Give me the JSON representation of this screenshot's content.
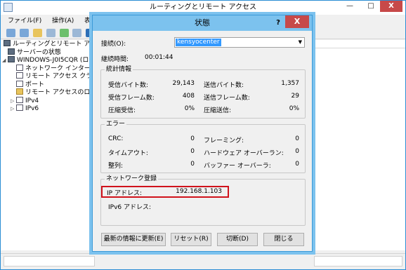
{
  "main": {
    "title": "ルーティングとリモート アクセス",
    "window_buttons": {
      "minimize": "—",
      "maximize": "□",
      "close": "X"
    },
    "menu": [
      "ファイル(F)",
      "操作(A)",
      "表示(V)"
    ],
    "tree": [
      {
        "label": "ルーティングとリモート アクセス",
        "icon": "server-icon",
        "expander": ""
      },
      {
        "label": "サーバーの状態",
        "icon": "server-icon",
        "expander": ""
      },
      {
        "label": "WINDOWS-J0I5CQR (ロ",
        "icon": "server-icon",
        "expander": "◢"
      },
      {
        "label": "ネットワーク インターフェ",
        "icon": "interface-icon",
        "expander": ""
      },
      {
        "label": "リモート アクセス クライア",
        "icon": "interface-icon",
        "expander": ""
      },
      {
        "label": "ポート",
        "icon": "interface-icon",
        "expander": ""
      },
      {
        "label": "リモート アクセスのログと",
        "icon": "folder-icon",
        "expander": ""
      },
      {
        "label": "IPv4",
        "icon": "interface-icon",
        "expander": "▷"
      },
      {
        "label": "IPv6",
        "icon": "interface-icon",
        "expander": "▷"
      }
    ]
  },
  "dialog": {
    "title": "状態",
    "help": "?",
    "close": "X",
    "connection_label": "接続(O):",
    "connection_value": "kensyocenter",
    "duration_label": "継続時間:",
    "duration_value": "00:01:44",
    "stats": {
      "title": "統計情報",
      "bytes_received_label": "受信バイト数:",
      "bytes_received": "29,143",
      "bytes_sent_label": "送信バイト数:",
      "bytes_sent": "1,357",
      "frames_received_label": "受信フレーム数:",
      "frames_received": "408",
      "frames_sent_label": "送信フレーム数:",
      "frames_sent": "29",
      "compression_in_label": "圧縮受信:",
      "compression_in": "0%",
      "compression_out_label": "圧縮送信:",
      "compression_out": "0%"
    },
    "errors": {
      "title": "エラー",
      "crc_label": "CRC:",
      "crc": "0",
      "framing_label": "フレーミング:",
      "framing": "0",
      "timeout_label": "タイムアウト:",
      "timeout": "0",
      "hw_overrun_label": "ハードウェア オーバーラン:",
      "hw_overrun": "0",
      "alignment_label": "整列:",
      "alignment": "0",
      "buffer_overrun_label": "バッファー オーバーラ:",
      "buffer_overrun": "0"
    },
    "network": {
      "title": "ネットワーク登録",
      "ip_label": "IP アドレス:",
      "ip_value": "192.168.1.103",
      "ipv6_label": "IPv6 アドレス:",
      "ipv6_value": ""
    },
    "buttons": {
      "refresh": "最新の情報に更新(E)",
      "reset": "リセット(R)",
      "disconnect": "切断(D)",
      "close": "閉じる"
    }
  },
  "colors": {
    "dialog_title_bg": "#7cc2ee",
    "close_button": "#c74949",
    "highlight_box": "#d0121b",
    "selection": "#3399ff"
  }
}
